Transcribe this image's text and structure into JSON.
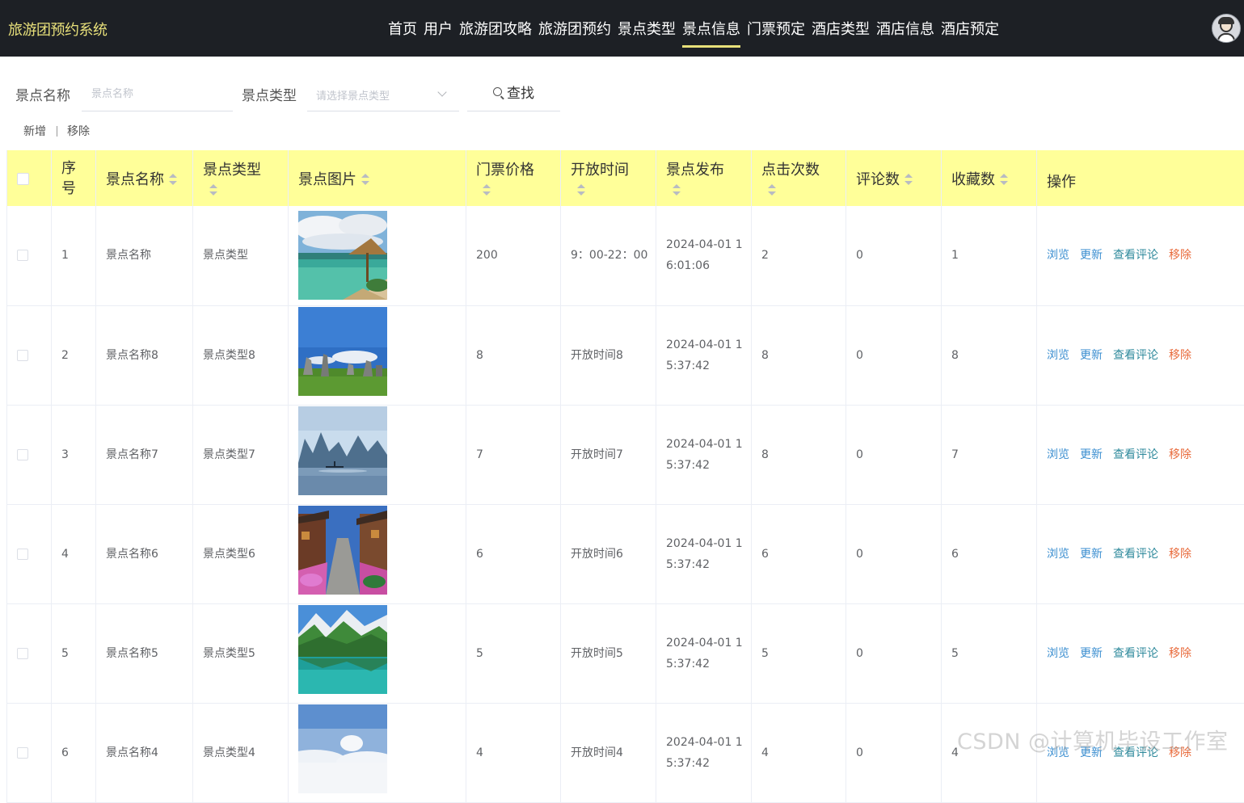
{
  "app": {
    "brand": "旅游团预约系统",
    "nav": [
      {
        "label": "首页",
        "active": false
      },
      {
        "label": "用户",
        "active": false
      },
      {
        "label": "旅游团攻略",
        "active": false
      },
      {
        "label": "旅游团预约",
        "active": false
      },
      {
        "label": "景点类型",
        "active": false
      },
      {
        "label": "景点信息",
        "active": true
      },
      {
        "label": "门票预定",
        "active": false
      },
      {
        "label": "酒店类型",
        "active": false
      },
      {
        "label": "酒店信息",
        "active": false
      },
      {
        "label": "酒店预定",
        "active": false
      }
    ],
    "accent_color": "#e8e07a",
    "header_bg": "#1d2025"
  },
  "search": {
    "name_label": "景点名称",
    "name_placeholder": "景点名称",
    "type_label": "景点类型",
    "type_placeholder": "请选择景点类型",
    "button": "查找"
  },
  "toolbar": {
    "add": "新增",
    "remove": "移除"
  },
  "table": {
    "header_bg": "#ffff99",
    "columns": [
      "序号",
      "景点名称",
      "景点类型",
      "景点图片",
      "门票价格",
      "开放时间",
      "景点发布",
      "点击次数",
      "评论数",
      "收藏数",
      "操作"
    ],
    "actions": {
      "view": "浏览",
      "update": "更新",
      "comments": "查看评论",
      "remove": "移除"
    },
    "rows": [
      {
        "index": "1",
        "name": "景点名称",
        "type": "景点类型",
        "image": "tropical-beach-hut",
        "price": "200",
        "open_time": "9：00-22：00",
        "published": "2024-04-01 16:01:06",
        "clicks": "2",
        "comments": "0",
        "favorites": "1"
      },
      {
        "index": "2",
        "name": "景点名称8",
        "type": "景点类型8",
        "image": "stone-forest",
        "price": "8",
        "open_time": "开放时间8",
        "published": "2024-04-01 15:37:42",
        "clicks": "8",
        "comments": "0",
        "favorites": "8"
      },
      {
        "index": "3",
        "name": "景点名称7",
        "type": "景点类型7",
        "image": "karst-river",
        "price": "7",
        "open_time": "开放时间7",
        "published": "2024-04-01 15:37:42",
        "clicks": "8",
        "comments": "0",
        "favorites": "7"
      },
      {
        "index": "4",
        "name": "景点名称6",
        "type": "景点类型6",
        "image": "old-town-street",
        "price": "6",
        "open_time": "开放时间6",
        "published": "2024-04-01 15:37:42",
        "clicks": "6",
        "comments": "0",
        "favorites": "6"
      },
      {
        "index": "5",
        "name": "景点名称5",
        "type": "景点类型5",
        "image": "mountain-lake",
        "price": "5",
        "open_time": "开放时间5",
        "published": "2024-04-01 15:37:42",
        "clicks": "5",
        "comments": "0",
        "favorites": "5"
      },
      {
        "index": "6",
        "name": "景点名称4",
        "type": "景点类型4",
        "image": "sea-of-clouds",
        "price": "4",
        "open_time": "开放时间4",
        "published": "2024-04-01 15:37:42",
        "clicks": "4",
        "comments": "0",
        "favorites": "4"
      }
    ]
  },
  "watermark": "CSDN @计算机毕设工作室"
}
